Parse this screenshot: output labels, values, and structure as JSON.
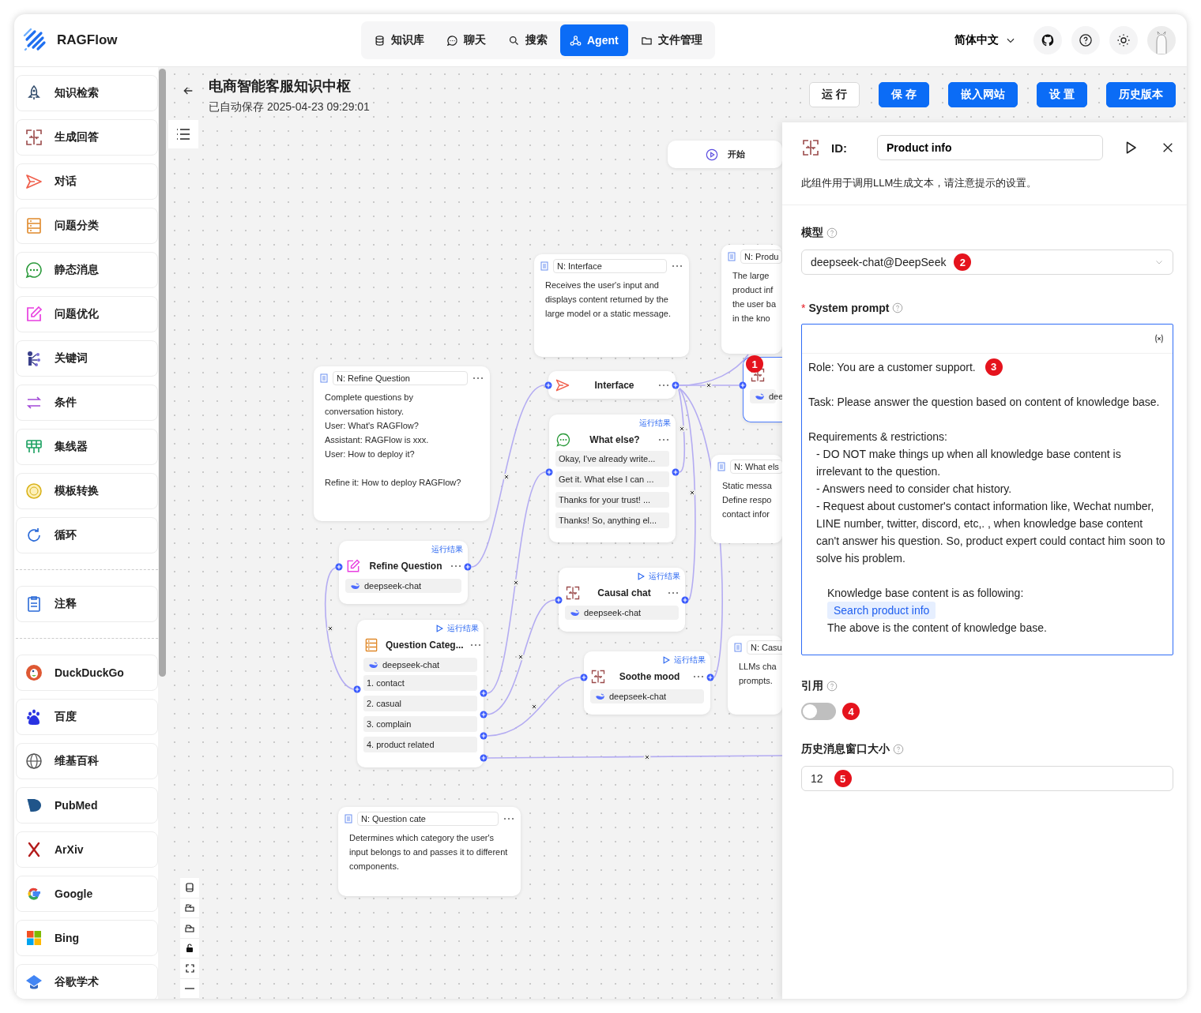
{
  "app": {
    "logo": "RAGFlow"
  },
  "nav": [
    {
      "label": "知识库",
      "kind": "database",
      "selected": false
    },
    {
      "label": "聊天",
      "kind": "chat",
      "selected": false
    },
    {
      "label": "搜索",
      "kind": "search",
      "selected": false
    },
    {
      "label": "Agent",
      "kind": "agent",
      "selected": true
    },
    {
      "label": "文件管理",
      "kind": "folder",
      "selected": false
    }
  ],
  "header_right": {
    "language": "简体中文"
  },
  "sidebar": {
    "groups": [
      {
        "items": [
          {
            "label": "知识检索",
            "kind": "retrieval"
          },
          {
            "label": "生成回答",
            "kind": "generate"
          },
          {
            "label": "对话",
            "kind": "answer"
          },
          {
            "label": "问题分类",
            "kind": "categorize"
          },
          {
            "label": "静态消息",
            "kind": "message"
          },
          {
            "label": "问题优化",
            "kind": "rewrite"
          },
          {
            "label": "关键词",
            "kind": "keyword"
          },
          {
            "label": "条件",
            "kind": "switch"
          },
          {
            "label": "集线器",
            "kind": "concentrator"
          },
          {
            "label": "模板转换",
            "kind": "template"
          },
          {
            "label": "循环",
            "kind": "iteration"
          }
        ]
      },
      {
        "items": [
          {
            "label": "注释",
            "kind": "note"
          }
        ]
      },
      {
        "items": [
          {
            "label": "DuckDuckGo",
            "kind": "duckduckgo"
          },
          {
            "label": "百度",
            "kind": "baidu"
          },
          {
            "label": "维基百科",
            "kind": "wikipedia"
          },
          {
            "label": "PubMed",
            "kind": "pubmed"
          },
          {
            "label": "ArXiv",
            "kind": "arxiv"
          },
          {
            "label": "Google",
            "kind": "google"
          },
          {
            "label": "Bing",
            "kind": "bing"
          },
          {
            "label": "谷歌学术",
            "kind": "scholar"
          }
        ]
      }
    ]
  },
  "workspace": {
    "title": "电商智能客服知识中枢",
    "saved": "已自动保存 2025-04-23 09:29:01",
    "actions": [
      {
        "label": "运 行",
        "kind": "outline"
      },
      {
        "label": "保 存",
        "kind": "primary"
      },
      {
        "label": "嵌入网站",
        "kind": "primary"
      },
      {
        "label": "设 置",
        "kind": "primary"
      },
      {
        "label": "历史版本",
        "kind": "primary"
      }
    ]
  },
  "canvas": {
    "nodes": [
      {
        "kind": "begin",
        "label": "开始"
      },
      {
        "kind": "note",
        "title": "N: Interface",
        "body": "Receives the user's input and displays content returned by the large model or a static message."
      },
      {
        "kind": "note",
        "title": "N: Produ",
        "body": "The large\nproduct inf\nthe user ba\nin the kno"
      },
      {
        "kind": "note",
        "title": "N: Refine Question",
        "body": "Complete questions by\nconversation history.\nUser: What's RAGFlow?\nAssistant: RAGFlow is xxx.\nUser: How to deploy it?\n\nRefine it: How to deploy RAGFlow?"
      },
      {
        "kind": "answer",
        "name": "Interface",
        "selected": false
      },
      {
        "kind": "generate",
        "model": "dee",
        "selected": true,
        "marker": "1"
      },
      {
        "kind": "message",
        "name": "What else?",
        "result": "运行结果",
        "run": false,
        "selected": false,
        "items": [
          "Okay, I've already write...",
          "Get it. What else I can ...",
          "Thanks for your trust! ...",
          "Thanks! So, anything el..."
        ]
      },
      {
        "kind": "note",
        "title": "N: What els",
        "body": "Static messa\nDefine respo\ncontact infor"
      },
      {
        "kind": "rewrite",
        "name": "Refine Question",
        "result": "运行结果",
        "run": false,
        "model": "deepseek-chat",
        "selected": false
      },
      {
        "kind": "generate",
        "name": "Causal chat",
        "result": "运行结果",
        "run": true,
        "model": "deepseek-chat",
        "selected": false
      },
      {
        "kind": "categorize",
        "name": "Question Categ...",
        "result": "运行结果",
        "run": true,
        "model": "deepseek-chat",
        "selected": false,
        "items": [
          "1. contact",
          "2. casual",
          "3. complain",
          "4. product related"
        ]
      },
      {
        "kind": "generate",
        "name": "Soothe mood",
        "result": "运行结果",
        "run": true,
        "model": "deepseek-chat",
        "selected": false
      },
      {
        "kind": "note",
        "title": "N: Casu",
        "body": "LLMs cha\nprompts."
      },
      {
        "kind": "note",
        "title": "N: Question cate",
        "body": "Determines which category the user's input belongs to and passes it to different components."
      }
    ]
  },
  "panel": {
    "id_label": "ID:",
    "id_value": "Product info",
    "description": "此组件用于调用LLM生成文本，请注意提示的设置。",
    "model": {
      "label": "模型",
      "value": "deepseek-chat@DeepSeek",
      "marker": "2"
    },
    "system_prompt": {
      "label": "System prompt",
      "required_mark": "*",
      "lines": [
        {
          "kind": "text",
          "text": "Role: You are a customer support.",
          "marker": "3"
        },
        {
          "kind": "blank"
        },
        {
          "kind": "text",
          "text": "Task: Please answer the question based on content of knowledge base."
        },
        {
          "kind": "blank"
        },
        {
          "kind": "text",
          "text": "Requirements & restrictions:"
        },
        {
          "kind": "bullet",
          "text": "- DO NOT make things up when all knowledge base content is irrelevant to the question."
        },
        {
          "kind": "bullet",
          "text": "- Answers need to consider chat history."
        },
        {
          "kind": "bullet",
          "text": "- Request about customer's contact information like, Wechat number, LINE number, twitter, discord, etc,. , when knowledge base content can't answer his question. So,  product expert could contact him soon to solve his problem."
        },
        {
          "kind": "blank"
        },
        {
          "kind": "indented",
          "text": "Knowledge base content is as following:"
        },
        {
          "kind": "variable",
          "text": "Search product info"
        },
        {
          "kind": "indented",
          "text": "The above is the content of knowledge base."
        }
      ]
    },
    "quote": {
      "label": "引用",
      "on": false,
      "marker": "4"
    },
    "history": {
      "label": "历史消息窗口大小",
      "value": "12",
      "marker": "5"
    }
  }
}
